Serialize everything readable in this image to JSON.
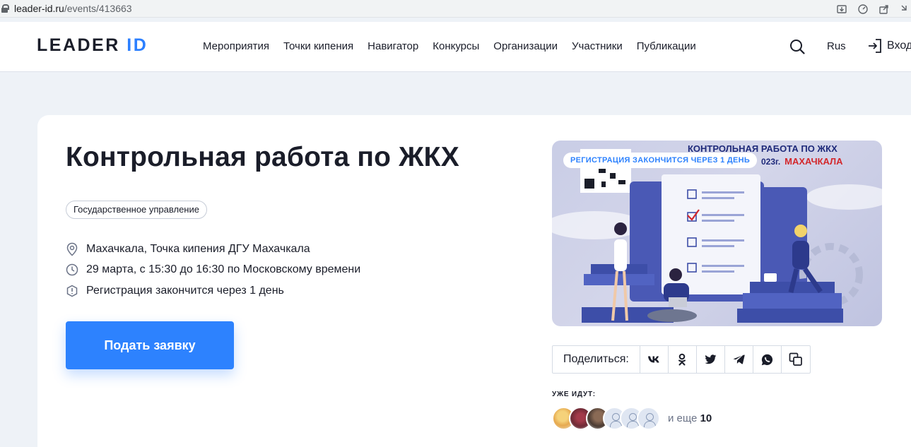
{
  "browser": {
    "url_host": "leader-id.ru",
    "url_path": "/events/413663"
  },
  "header": {
    "logo_main": "LEADER",
    "logo_accent": "ID",
    "nav": [
      "Мероприятия",
      "Точки кипения",
      "Навигатор",
      "Конкурсы",
      "Организации",
      "Участники",
      "Публикации"
    ],
    "lang": "Rus",
    "login": "Вход",
    "accent_color": "#2b7fff"
  },
  "event": {
    "title": "Контрольная работа по ЖКХ",
    "tag": "Государственное управление",
    "location": "Махачкала, Точка кипения ДГУ Махачкала",
    "time": "29 марта, с 15:30 до 16:30 по Московскому времени",
    "registration": "Регистрация закончится через 1 день",
    "apply_label": "Подать заявку"
  },
  "banner": {
    "badge": "РЕГИСТРАЦИЯ ЗАКОНЧИТСЯ ЧЕРЕЗ 1 ДЕНЬ",
    "heading": "КОНТРОЛЬНАЯ РАБОТА ПО ЖКХ",
    "year": "023г.",
    "city": "МАХАЧКАЛА"
  },
  "share": {
    "label": "Поделиться:",
    "icons": [
      "vk-icon",
      "odnoklassniki-icon",
      "twitter-icon",
      "telegram-icon",
      "whatsapp-icon",
      "copy-link-icon"
    ]
  },
  "going": {
    "label": "УЖЕ ИДУТ:",
    "more_prefix": "и еще",
    "more_count": "10"
  }
}
